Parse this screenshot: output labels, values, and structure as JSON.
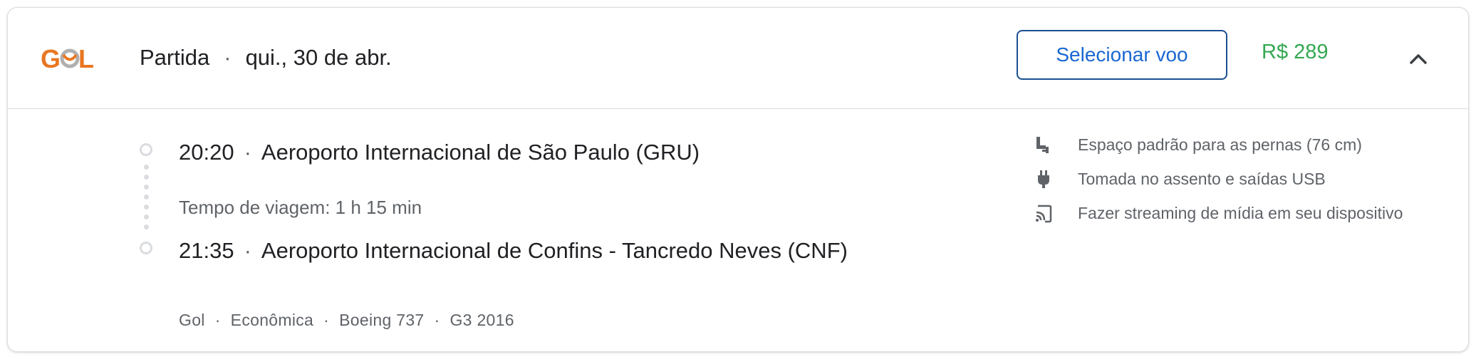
{
  "header": {
    "airline_logo_text": "GOL",
    "direction_label": "Partida",
    "date": "qui., 30 de abr.",
    "select_button_label": "Selecionar voo",
    "price": "R$ 289",
    "collapse_icon": "chevron-up-icon"
  },
  "itinerary": {
    "departure_time": "20:20",
    "departure_airport": "Aeroporto Internacional de São Paulo (GRU)",
    "duration": "Tempo de viagem: 1 h 15 min",
    "arrival_time": "21:35",
    "arrival_airport": "Aeroporto Internacional de Confins - Tancredo Neves (CNF)"
  },
  "details": {
    "airline": "Gol",
    "cabin": "Econômica",
    "aircraft": "Boeing 737",
    "flight_number": "G3 2016"
  },
  "amenities": [
    {
      "icon": "seat-legroom-icon",
      "text": "Espaço padrão para as pernas (76 cm)"
    },
    {
      "icon": "power-plug-icon",
      "text": "Tomada no assento e saídas USB"
    },
    {
      "icon": "cast-streaming-icon",
      "text": "Fazer streaming de mídia em seu dispositivo"
    }
  ],
  "colors": {
    "accent_blue": "#1967d2",
    "price_green": "#34a853",
    "logo_orange": "#e87722"
  }
}
